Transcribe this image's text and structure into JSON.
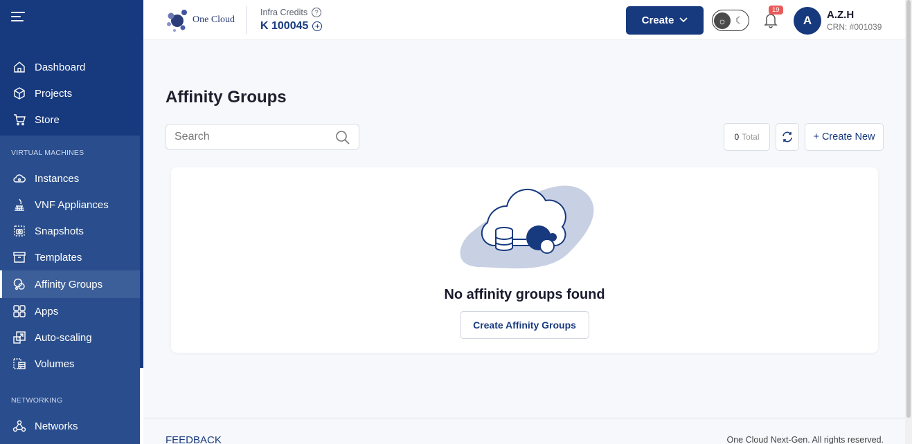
{
  "sidebar": {
    "top_items": [
      {
        "label": "Dashboard",
        "icon": "home-icon"
      },
      {
        "label": "Projects",
        "icon": "cube-icon"
      },
      {
        "label": "Store",
        "icon": "cart-icon"
      }
    ],
    "vm_section_title": "VIRTUAL MACHINES",
    "vm_items": [
      {
        "label": "Instances",
        "icon": "cloud-icon"
      },
      {
        "label": "VNF Appliances",
        "icon": "firewall-icon"
      },
      {
        "label": "Snapshots",
        "icon": "camera-icon"
      },
      {
        "label": "Templates",
        "icon": "archive-icon"
      },
      {
        "label": "Affinity Groups",
        "icon": "affinity-icon",
        "active": true
      },
      {
        "label": "Apps",
        "icon": "apps-grid-icon"
      },
      {
        "label": "Auto-scaling",
        "icon": "scale-icon"
      },
      {
        "label": "Volumes",
        "icon": "volumes-icon"
      }
    ],
    "net_section_title": "NETWORKING",
    "net_items": [
      {
        "label": "Networks",
        "icon": "network-icon"
      }
    ]
  },
  "header": {
    "logo_text": "One Cloud",
    "credits_label": "Infra Credits",
    "credits_value": "K 100045",
    "create_label": "Create",
    "notification_count": "19",
    "avatar_initial": "A",
    "user_name": "A.Z.H",
    "user_crn": "CRN: #001039"
  },
  "main": {
    "title": "Affinity Groups",
    "search_placeholder": "Search",
    "total_count": "0",
    "total_label": "Total",
    "create_new_label": "+ Create New",
    "empty_message": "No affinity groups found",
    "empty_button_label": "Create Affinity Groups"
  },
  "footer": {
    "feedback_label": "FEEDBACK",
    "copyright": "One Cloud Next-Gen. All rights reserved."
  },
  "colors": {
    "brand": "#17397e",
    "sidebar_section": "#2a4e8d",
    "active_item": "#3d5f99",
    "badge": "#e95b5b"
  }
}
